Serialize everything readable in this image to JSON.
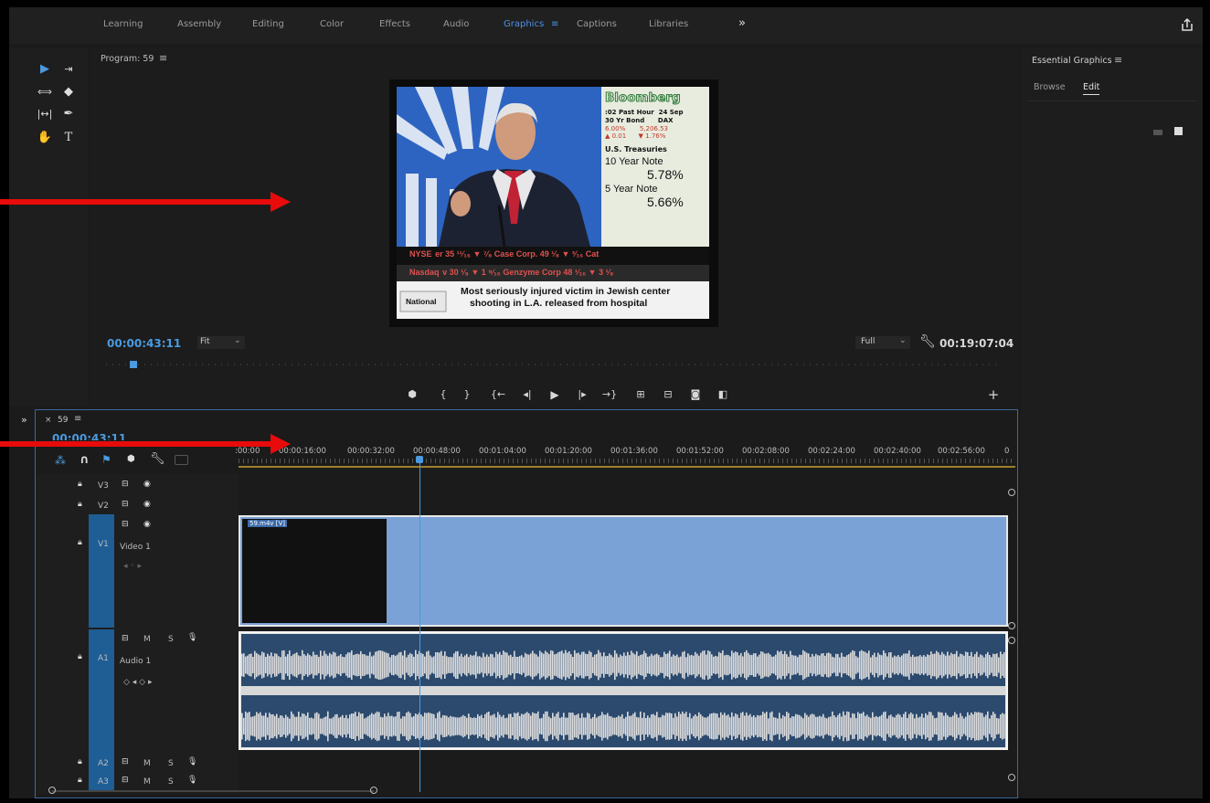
{
  "workspaces": [
    {
      "label": "Learning",
      "active": false
    },
    {
      "label": "Assembly",
      "active": false
    },
    {
      "label": "Editing",
      "active": false
    },
    {
      "label": "Color",
      "active": false
    },
    {
      "label": "Effects",
      "active": false
    },
    {
      "label": "Audio",
      "active": false
    },
    {
      "label": "Graphics",
      "active": true
    },
    {
      "label": "Captions",
      "active": false
    },
    {
      "label": "Libraries",
      "active": false
    }
  ],
  "workspace_more": "»",
  "menu_glyph": "≡",
  "program": {
    "title": "Program: 59",
    "timecode": "00:00:43:11",
    "zoom": "Fit",
    "resolution": "Full",
    "duration": "00:19:07:04"
  },
  "broadcast": {
    "brand": "Bloomberg",
    "line1": ":02 Past Hour  24 Sep",
    "line2": "30 Yr Bond      DAX",
    "line3": "6.00%       5,206.53",
    "line4": "▲ 0.01      ▼ 1.76%",
    "treasuries": "U.S. Treasuries",
    "note10_label": "10 Year Note",
    "note10_value": "5.78%",
    "note5_label": "5 Year Note",
    "note5_value": "5.66%",
    "ticker1": "NYSE  er 35 ¹¹⁄₁₆ ▼ ⁷⁄₈   Case Corp. 49 ¹⁄₈ ▼ ³⁄₁₆  Cat",
    "ticker2": "Nasdaq  v 30 ¹⁄₈ ▼ 1 ⁹⁄₁₆  Genzyme Corp 48 ¹⁄₁₆ ▼ 3 ¹⁄₈",
    "news_tag": "National",
    "headline1": "Most seriously injured victim in Jewish center",
    "headline2": "shooting in L.A. released from hospital"
  },
  "essential_graphics": {
    "title": "Essential Graphics",
    "tab_browse": "Browse",
    "tab_edit": "Edit"
  },
  "timeline": {
    "sequence_name": "59",
    "close_glyph": "×",
    "timecode": "00:00:43:11",
    "ruler": [
      ":00:00",
      "00:00:16:00",
      "00:00:32:00",
      "00:00:48:00",
      "00:01:04:00",
      "00:01:20:00",
      "00:01:36:00",
      "00:01:52:00",
      "00:02:08:00",
      "00:02:24:00",
      "00:02:40:00",
      "00:02:56:00",
      "0"
    ],
    "tracks": {
      "v3": "V3",
      "v2": "V2",
      "v1": "V1",
      "v1_name": "Video 1",
      "a1": "A1",
      "a1_name": "Audio 1",
      "a2": "A2",
      "a3": "A3"
    },
    "clip_video": "59.m4v [V]",
    "mute": "M",
    "solo": "S",
    "playhead_fraction": 0.233
  }
}
